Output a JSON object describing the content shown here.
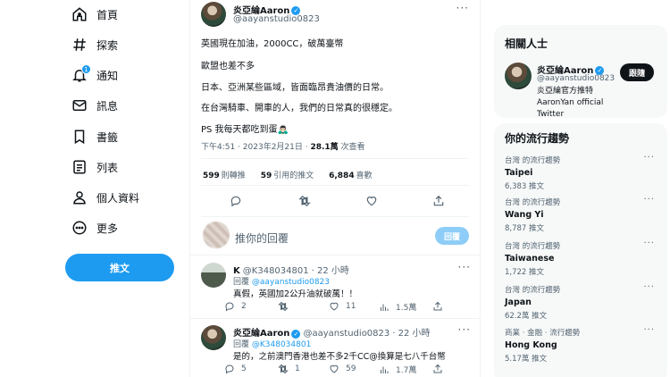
{
  "colors": {
    "accent": "#1d9bf0",
    "text": "#0f1419",
    "muted": "#536471",
    "panel": "#f7f9f9"
  },
  "sidebar": {
    "items": [
      {
        "label": "首頁",
        "icon": "home-icon"
      },
      {
        "label": "探索",
        "icon": "hashtag-icon"
      },
      {
        "label": "通知",
        "icon": "bell-icon",
        "badge": "1"
      },
      {
        "label": "訊息",
        "icon": "envelope-icon"
      },
      {
        "label": "書籤",
        "icon": "bookmark-icon"
      },
      {
        "label": "列表",
        "icon": "list-icon"
      },
      {
        "label": "個人資料",
        "icon": "person-icon"
      },
      {
        "label": "更多",
        "icon": "more-circle-icon"
      }
    ],
    "tweet_button": "推文"
  },
  "tweet": {
    "name": "炎亞綸Aaron",
    "handle": "@aayanstudio0823",
    "lines": [
      "英國現在加油，2000CC，破萬臺幣",
      "歐盟也差不多",
      "日本、亞洲某些區域，皆面臨昂貴油價的日常。",
      "在台灣騎車、開車的人，我們的日常真的很穩定。",
      "PS 我每天都吃到蛋🙇🏻‍♂️"
    ],
    "time": "下午4:51 · 2023年2月21日 · ",
    "views": "28.1萬",
    "views_label": " 次查看",
    "retweets": "599",
    "retweets_label": "則轉推",
    "quotes": "59",
    "quotes_label": "引用的推文",
    "likes": "6,884",
    "likes_label": "喜歡"
  },
  "reply_composer": {
    "placeholder": "推你的回覆",
    "button": "回覆"
  },
  "replies": [
    {
      "name": "K",
      "handle": "@K348034801",
      "time": "· 22 小時",
      "reply_to_label": "回覆 ",
      "reply_to": "@aayanstudio0823",
      "text": "真假，英國加2公升油就破萬！！",
      "counts": {
        "reply": "2",
        "retweet": "",
        "like": "11",
        "views": "1.5萬"
      }
    },
    {
      "name": "炎亞綸Aaron",
      "handle": "@aayanstudio0823",
      "time": "· 22 小時",
      "reply_to_label": "回覆 ",
      "reply_to": "@K348034801",
      "text": "是的，之前澳門香港也差不多2千CC@換算是七八千台幣",
      "counts": {
        "reply": "5",
        "retweet": "1",
        "like": "59",
        "views": "1.7萬"
      }
    }
  ],
  "who": {
    "title": "相關人士",
    "name": "炎亞綸Aaron",
    "handle": "@aayanstudio0823",
    "bio": "炎亞綸官方推特 AaronYan official Twitter",
    "follow": "跟隨"
  },
  "trends": {
    "title": "你的流行趨勢",
    "items": [
      {
        "context": "台灣 的流行趨勢",
        "topic": "Taipei",
        "count": "6,383 推文"
      },
      {
        "context": "台灣 的流行趨勢",
        "topic": "Wang Yi",
        "count": "8,787 推文"
      },
      {
        "context": "台灣 的流行趨勢",
        "topic": "Taiwanese",
        "count": "1,722 推文"
      },
      {
        "context": "台灣 的流行趨勢",
        "topic": "Japan",
        "count": "62.2萬 推文"
      },
      {
        "context": "商業 · 金融 · 流行趨勢",
        "topic": "Hong Kong",
        "count": "5.17萬 推文"
      }
    ]
  }
}
